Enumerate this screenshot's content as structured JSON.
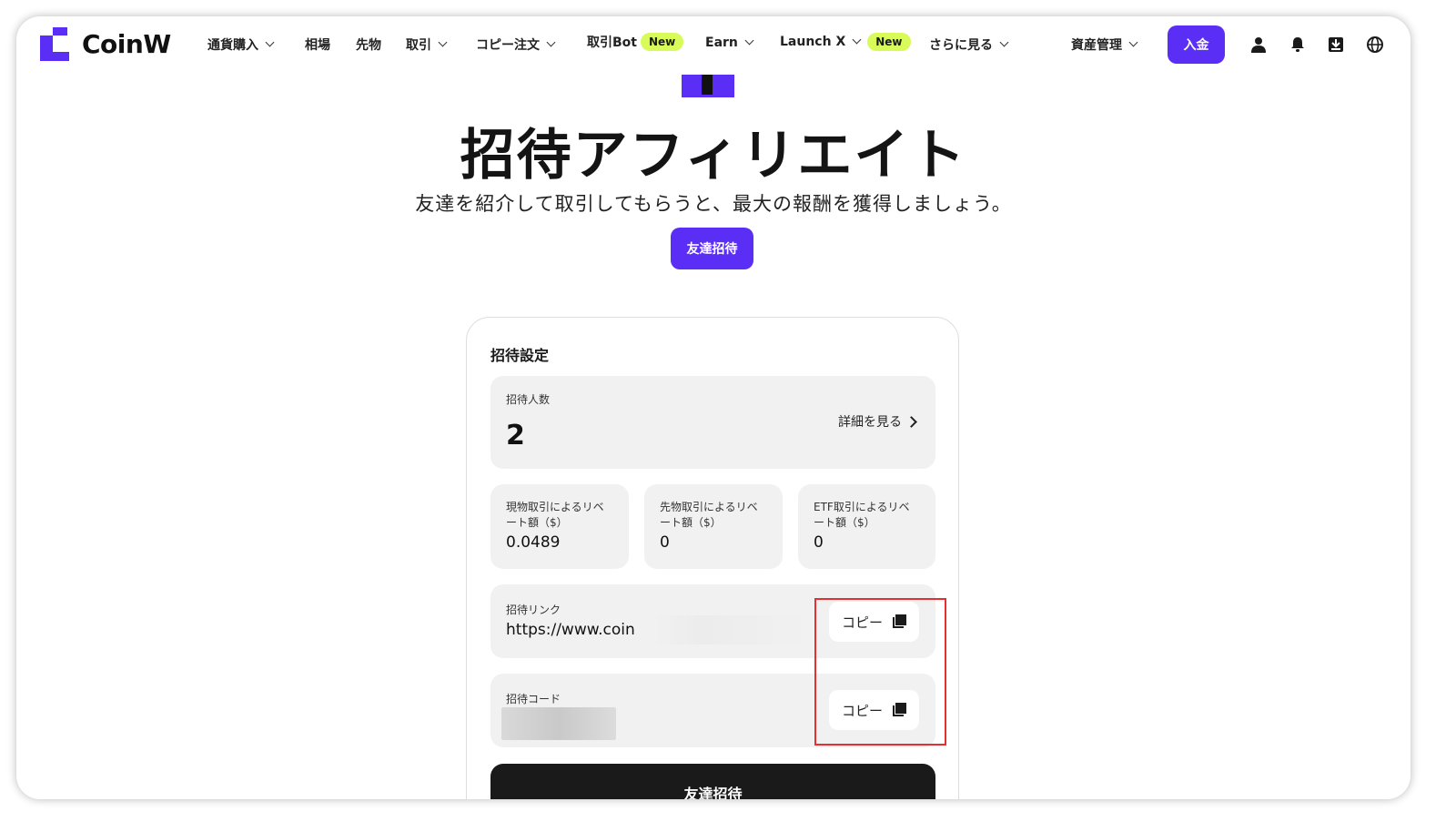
{
  "brand": {
    "name": "CoinW",
    "accent": "#5b2ef5",
    "new_badge_color": "#d8fb5a"
  },
  "nav": {
    "items": [
      {
        "label": "通貨購入",
        "dropdown": true
      },
      {
        "label": "相場",
        "dropdown": false
      },
      {
        "label": "先物",
        "dropdown": false
      },
      {
        "label": "取引",
        "dropdown": true
      },
      {
        "label": "コピー注文",
        "dropdown": true
      },
      {
        "label": "取引Bot",
        "badge": "New"
      },
      {
        "label": "Earn",
        "dropdown": true
      },
      {
        "label": "Launch X",
        "dropdown": true,
        "badge": "New"
      },
      {
        "label": "さらに見る",
        "dropdown": true
      }
    ],
    "asset_management": "資産管理",
    "deposit_label": "入金",
    "icons": [
      "user-icon",
      "bell-icon",
      "download-icon",
      "globe-icon"
    ]
  },
  "hero": {
    "title": "招待アフィリエイト",
    "subtitle": "友達を紹介して取引してもらうと、最大の報酬を獲得しましょう。",
    "button_label": "友達招待"
  },
  "invite_settings": {
    "title": "招待設定",
    "invite_count_label": "招待人数",
    "invite_count": "2",
    "detail_link": "詳細を見る",
    "rebates": [
      {
        "label_line1": "現物取引によるリベ",
        "label_line2": "ート額（$）",
        "value": "0.0489"
      },
      {
        "label_line1": "先物取引によるリベ",
        "label_line2": "ート額（$）",
        "value": "0"
      },
      {
        "label_line1": "ETF取引によるリベ",
        "label_line2": "ート額（$）",
        "value": "0"
      }
    ],
    "invite_link_label": "招待リンク",
    "invite_link_value": "https://www.coin",
    "invite_code_label": "招待コード",
    "copy_label": "コピー",
    "invite_button": "友達招待"
  },
  "annotation": {
    "highlight_color": "#e53030"
  }
}
